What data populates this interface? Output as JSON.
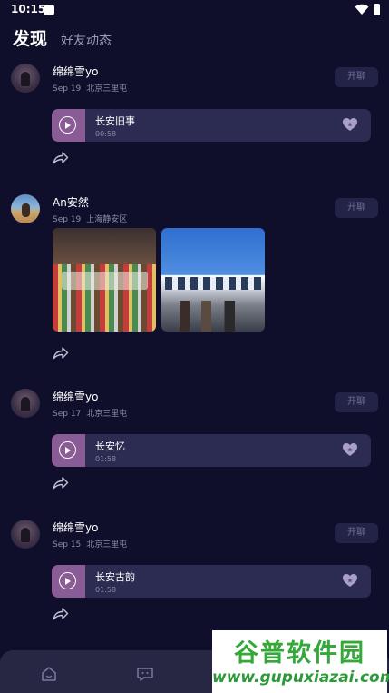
{
  "status_bar": {
    "time": "10:15"
  },
  "tabs": {
    "active": "发现",
    "inactive": "好友动态"
  },
  "chat_label": "开聊",
  "posts": [
    {
      "username": "绵绵雪yo",
      "date": "Sep 19",
      "location": "北京三里屯",
      "audio": {
        "title": "长安旧事",
        "duration": "00:58"
      }
    },
    {
      "username": "An安然",
      "date": "Sep 19",
      "location": "上海静安区"
    },
    {
      "username": "绵绵雪yo",
      "date": "Sep 17",
      "location": "北京三里屯",
      "audio": {
        "title": "长安忆",
        "duration": "01:58"
      }
    },
    {
      "username": "绵绵雪yo",
      "date": "Sep 15",
      "location": "北京三里屯",
      "audio": {
        "title": "长安古韵",
        "duration": "01:58"
      }
    }
  ],
  "watermark": {
    "brand": "谷普软件园",
    "url": "www.gupuxiazai.com"
  },
  "colors": {
    "background": "#0f0f2c",
    "accent": "#8a5c96",
    "card": "#2c2c52"
  },
  "icons": [
    "play-icon",
    "heart-icon",
    "share-icon",
    "home-icon",
    "chat-icon",
    "wifi-icon",
    "battery-icon"
  ]
}
